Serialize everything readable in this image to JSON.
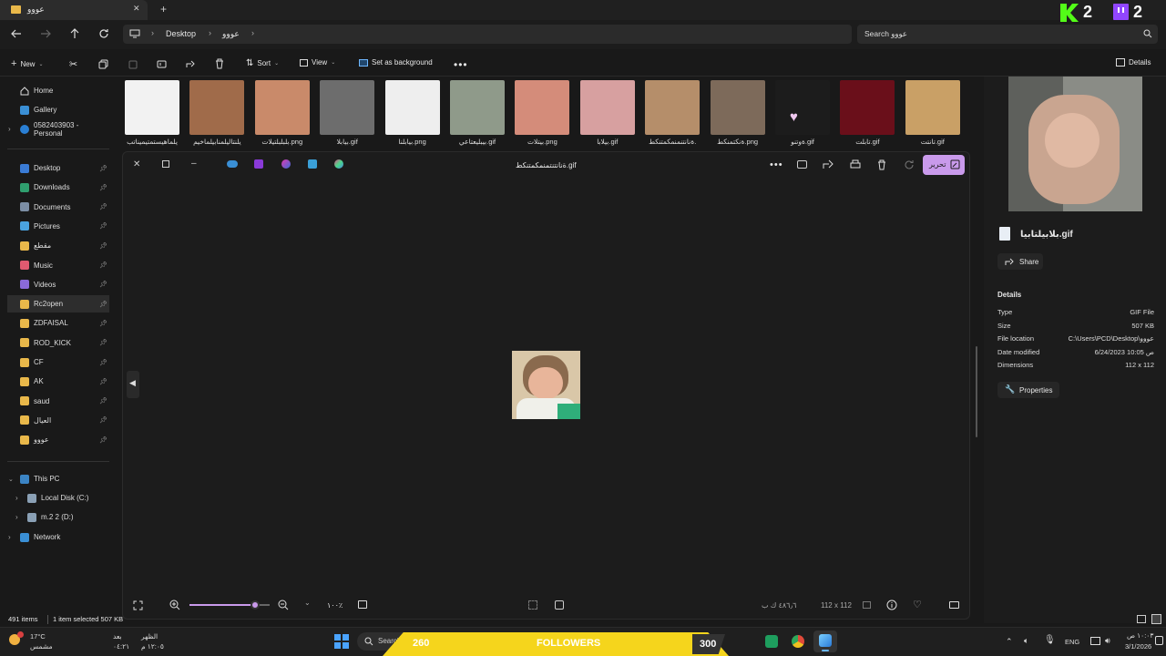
{
  "window": {
    "tab_title": "عووو",
    "new_tab": "+",
    "close": "✕"
  },
  "nav": {
    "breadcrumb": [
      "Desktop",
      "عووو"
    ],
    "search_placeholder": "Search عووو"
  },
  "commands": {
    "new_label": "New",
    "sort_label": "Sort",
    "view_label": "View",
    "set_background_label": "Set as background",
    "details_label": "Details"
  },
  "sidebar": {
    "top": [
      {
        "label": "Home",
        "icon": "home-icon"
      },
      {
        "label": "Gallery",
        "icon": "gallery-icon"
      },
      {
        "label": "0582403903 - Personal",
        "icon": "onedrive-icon"
      }
    ],
    "quick": [
      {
        "label": "Desktop",
        "icon": "desktop-icon",
        "color": "#3a7bd5"
      },
      {
        "label": "Downloads",
        "icon": "download-icon",
        "color": "#2f9e6e"
      },
      {
        "label": "Documents",
        "icon": "documents-icon",
        "color": "#7c8ea5"
      },
      {
        "label": "Pictures",
        "icon": "pictures-icon",
        "color": "#4aa3df"
      },
      {
        "label": "مقطع",
        "icon": "folder-icon",
        "color": "#e9b84a"
      },
      {
        "label": "Music",
        "icon": "music-icon",
        "color": "#e05a70"
      },
      {
        "label": "Videos",
        "icon": "videos-icon",
        "color": "#8a6ad8"
      },
      {
        "label": "Rc2open",
        "icon": "folder-icon",
        "color": "#e9b84a"
      },
      {
        "label": "ZDFAISAL",
        "icon": "folder-icon",
        "color": "#e9b84a"
      },
      {
        "label": "ROD_KICK",
        "icon": "folder-icon",
        "color": "#e9b84a"
      },
      {
        "label": "CF",
        "icon": "folder-icon",
        "color": "#e9b84a"
      },
      {
        "label": "AK",
        "icon": "folder-icon",
        "color": "#e9b84a"
      },
      {
        "label": "saud",
        "icon": "folder-icon",
        "color": "#e9b84a"
      },
      {
        "label": "العيال",
        "icon": "folder-icon",
        "color": "#e9b84a"
      },
      {
        "label": "عووو",
        "icon": "folder-icon",
        "color": "#e9b84a"
      }
    ],
    "pc": [
      {
        "label": "This PC",
        "icon": "pc-icon"
      },
      {
        "label": "Local Disk (C:)",
        "icon": "drive-icon"
      },
      {
        "label": "m.2 2 (D:)",
        "icon": "drive-icon"
      },
      {
        "label": "Network",
        "icon": "network-icon"
      }
    ]
  },
  "thumbnails": [
    {
      "label": "يلماهيستمتيميناتب",
      "color": "#f2f2f2"
    },
    {
      "label": "يلنتاليلمنابيلماخيم",
      "color": "#a06b4a"
    },
    {
      "label": "بلبلبلتيلات.png",
      "color": "#c98a6a"
    },
    {
      "label": "بيابلا.gif",
      "color": "#6d6d6d"
    },
    {
      "label": "بيابلنا.png",
      "color": "#eeeeee"
    },
    {
      "label": "بيبليعتاعي.gif",
      "color": "#8f9a8a"
    },
    {
      "label": "بيتلات.png",
      "color": "#d48c7a"
    },
    {
      "label": "بيلابا.gif",
      "color": "#d7a0a0"
    },
    {
      "label": "ةنانتنمنمكمتنكط.",
      "color": "#b58e6a"
    },
    {
      "label": "ةنكتمنكط.png",
      "color": "#7d6a5a"
    },
    {
      "label": "ةوتنو.gif",
      "color": "#1c1c1c"
    },
    {
      "label": "تابلت.gif",
      "color": "#6a0f1a"
    },
    {
      "label": "تانتت.gif",
      "color": "#c9a066"
    }
  ],
  "viewer": {
    "file_title": "ةنانتنتمنمكمتنكط.gif",
    "edit_label": "تحرير",
    "zoom_label": "١٠٠٪",
    "dimensions": "112 x 112",
    "file_size": "٤٨٦٫٦ ك ب"
  },
  "details": {
    "filename": "بلابيلتابيا.gif",
    "share_label": "Share",
    "section_title": "Details",
    "rows": [
      {
        "k": "Type",
        "v": "GIF File"
      },
      {
        "k": "Size",
        "v": "507 KB"
      },
      {
        "k": "File location",
        "v": "C:\\Users\\PCD\\Desktop\\عووو"
      },
      {
        "k": "Date modified",
        "v": "6/24/2023 10:05 ص"
      },
      {
        "k": "Dimensions",
        "v": "112 x 112"
      }
    ],
    "properties_label": "Properties"
  },
  "status": {
    "items": "491 items",
    "selected": "1 item selected  507 KB"
  },
  "stream_overlay": {
    "kick_count": "2",
    "twitch_count": "2",
    "left_number": "260",
    "banner": "FOLLOWERS",
    "right_number": "300"
  },
  "taskbar": {
    "temp": "17°C",
    "weather": "مشمس",
    "prayer1_name": "بعد",
    "prayer1_time": "٠٤:٢١",
    "prayer2_name": "الظهر",
    "prayer2_time": "١٢:٠٥ م",
    "search": "Search",
    "lang": "ENG",
    "time": "١٠:٠٣ ص",
    "date": "3/1/2026"
  }
}
